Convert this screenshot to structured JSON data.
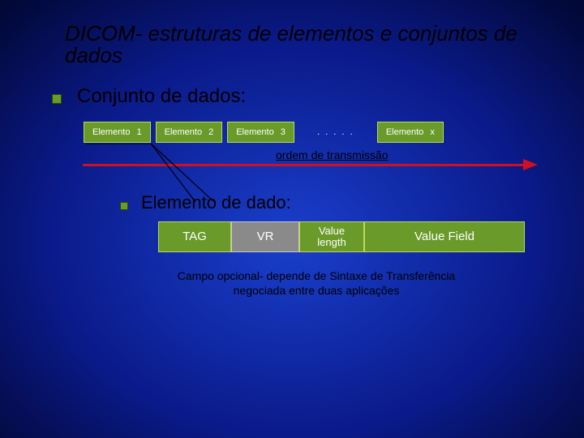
{
  "title": "DICOM- estruturas de elementos e conjuntos de dados",
  "section1": {
    "heading": "Conjunto de dados:",
    "elements": [
      {
        "label": "Elemento",
        "n": "1"
      },
      {
        "label": "Elemento",
        "n": "2"
      },
      {
        "label": "Elemento",
        "n": "3"
      }
    ],
    "ellipsis": ". . . . .",
    "last": {
      "label": "Elemento",
      "n": "x"
    },
    "arrow_label": "ordem de transmissão"
  },
  "section2": {
    "heading": "Elemento de dado:",
    "cells": {
      "tag": "TAG",
      "vr": "VR",
      "vlen_top": "Value",
      "vlen_bot": "length",
      "vfield": "Value Field"
    },
    "footnote_l1": "Campo opcional- depende de Sintaxe de Transferência",
    "footnote_l2": "negociada entre duas aplicações"
  }
}
